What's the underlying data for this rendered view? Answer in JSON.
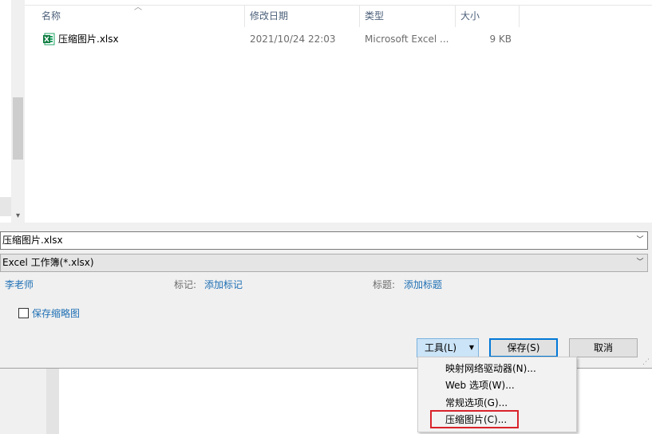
{
  "file_list": {
    "headers": {
      "name": "名称",
      "modified": "修改日期",
      "type": "类型",
      "size": "大小"
    },
    "files": [
      {
        "name": "压缩图片.xlsx",
        "modified": "2021/10/24 22:03",
        "type": "Microsoft Excel ...",
        "size": "9 KB",
        "icon": "excel-file-icon"
      }
    ]
  },
  "save_form": {
    "filename": "压缩图片.xlsx",
    "filetype": "Excel 工作簿(*.xlsx)",
    "author": "李老师",
    "tags_label": "标记:",
    "tags_link": "添加标记",
    "title_label": "标题:",
    "title_link": "添加标题",
    "thumbnail_label": "保存缩略图",
    "thumbnail_checked": false
  },
  "buttons": {
    "tools": "工具(L)",
    "save": "保存(S)",
    "cancel": "取消"
  },
  "tools_menu": {
    "items": [
      "映射网络驱动器(N)...",
      "Web 选项(W)...",
      "常规选项(G)...",
      "压缩图片(C)..."
    ],
    "highlighted_index": 3,
    "highlight_color": "#d9222a"
  },
  "colors": {
    "link": "#1e6fb4",
    "header_text": "#4c607a",
    "primary_border": "#0078d7"
  }
}
